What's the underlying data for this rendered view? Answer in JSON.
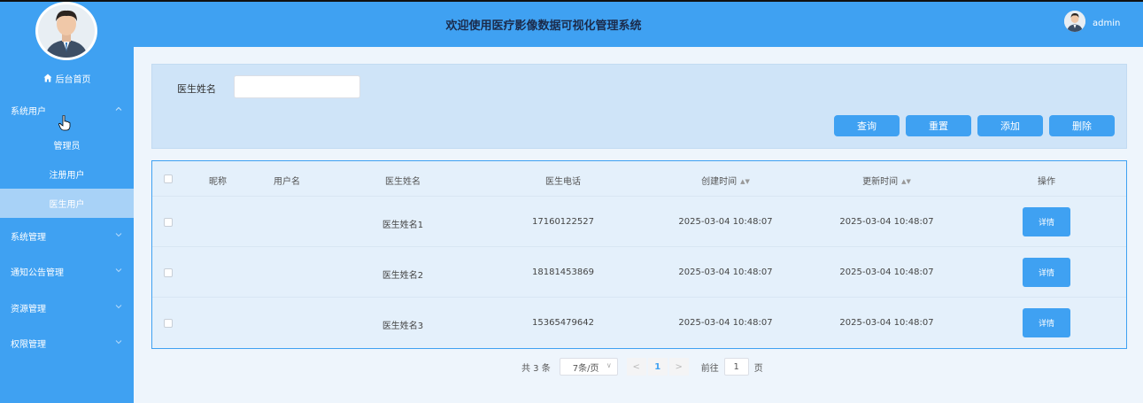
{
  "header": {
    "title": "欢迎使用医疗影像数据可视化管理系统",
    "username": "admin"
  },
  "sidebar": {
    "home": {
      "label": "后台首页",
      "icon": "home-icon"
    },
    "groups": [
      {
        "label": "系统用户",
        "expanded": true,
        "items": [
          {
            "label": "管理员"
          },
          {
            "label": "注册用户"
          },
          {
            "label": "医生用户",
            "active": true
          }
        ]
      },
      {
        "label": "系统管理",
        "expanded": false
      },
      {
        "label": "通知公告管理",
        "expanded": false
      },
      {
        "label": "资源管理",
        "expanded": false
      },
      {
        "label": "权限管理",
        "expanded": false
      }
    ]
  },
  "search": {
    "field_label": "医生姓名",
    "field_value": "",
    "buttons": {
      "query": "查询",
      "reset": "重置",
      "add": "添加",
      "delete": "删除"
    }
  },
  "table": {
    "columns": [
      "昵称",
      "用户名",
      "医生姓名",
      "医生电话",
      "创建时间",
      "更新时间",
      "操作"
    ],
    "rows": [
      {
        "nickname": "",
        "username": "",
        "doctor_name": "医生姓名1",
        "phone": "17160122527",
        "created": "2025-03-04 10:48:07",
        "updated": "2025-03-04 10:48:07",
        "action": "详情"
      },
      {
        "nickname": "",
        "username": "",
        "doctor_name": "医生姓名2",
        "phone": "18181453869",
        "created": "2025-03-04 10:48:07",
        "updated": "2025-03-04 10:48:07",
        "action": "详情"
      },
      {
        "nickname": "",
        "username": "",
        "doctor_name": "医生姓名3",
        "phone": "15365479642",
        "created": "2025-03-04 10:48:07",
        "updated": "2025-03-04 10:48:07",
        "action": "详情"
      }
    ]
  },
  "pagination": {
    "total": "共 3 条",
    "page_size": "7条/页",
    "prev": "<",
    "current_page": "1",
    "next": ">",
    "jump_label": "前往",
    "jump_value": "1",
    "jump_suffix": "页"
  },
  "colors": {
    "accent": "#3fa1f2",
    "sidebar_active": "#a8d2f7",
    "panel": "#cfe4f8"
  }
}
